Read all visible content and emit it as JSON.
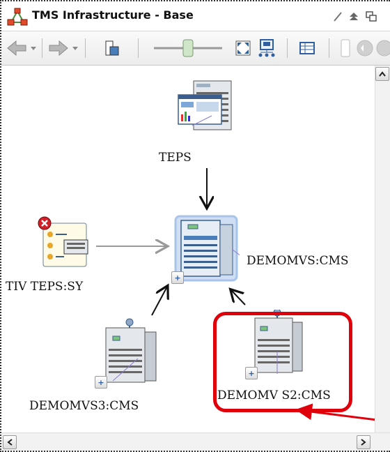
{
  "window": {
    "title": "TMS Infrastructure - Base",
    "app_icon": "topology-icon",
    "title_actions": [
      "edit-icon",
      "maximize-icon",
      "restore-icon"
    ]
  },
  "toolbar": {
    "items": [
      "back-arrow-icon",
      "back-dropdown-icon",
      "forward-arrow-icon",
      "forward-dropdown-icon",
      "view-icon",
      "zoom-slider",
      "fit-to-window-icon",
      "arrange-icon",
      "table-view-icon",
      "toggle-icon"
    ]
  },
  "nodes": {
    "teps": {
      "label": "TEPS",
      "icon": "teps-server-icon"
    },
    "demomvs_cms": {
      "label": "DEMOMVS:CMS",
      "icon": "server-tower-icon"
    },
    "tivteps_sy": {
      "label": "TIV TEPS:SY",
      "icon": "agent-error-icon"
    },
    "demomvs3_cms": {
      "label": "DEMOMVS3:CMS",
      "icon": "server-tower-icon"
    },
    "demomvs2_cms": {
      "label": "DEMOMV S2:CMS",
      "icon": "server-tower-icon"
    }
  },
  "expand_symbol": "+",
  "colors": {
    "highlight": "#e0000b",
    "server_blue": "#4a7ebb",
    "selection": "#a9c4ea"
  }
}
